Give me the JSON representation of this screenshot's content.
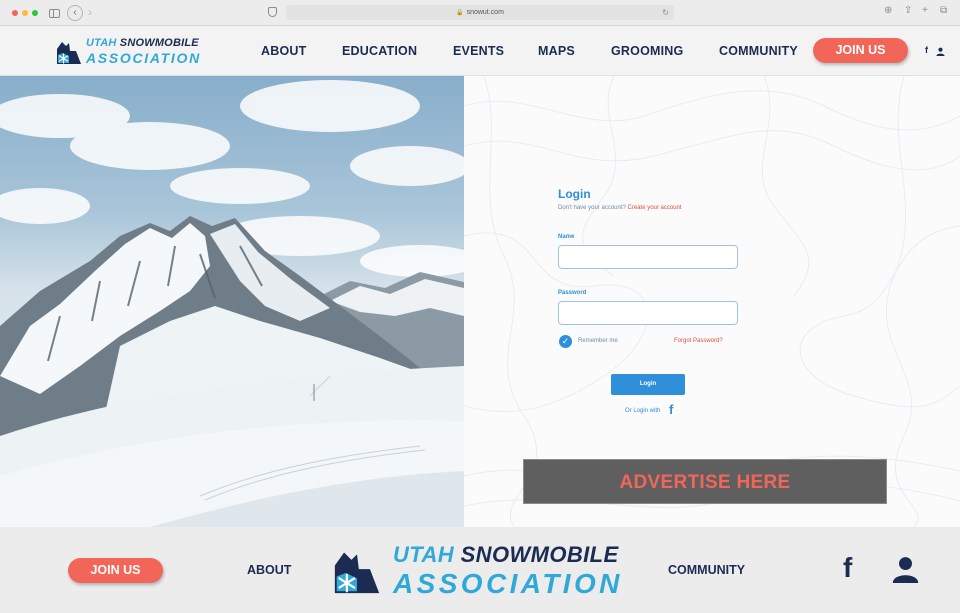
{
  "browser": {
    "url": "snowut.com"
  },
  "brand": {
    "line1_highlight": "UTAH",
    "line1_rest": " SNOWMOBILE",
    "line2": "ASSOCIATION",
    "colors": {
      "navy": "#1b2b52",
      "sky": "#31a9d8",
      "coral": "#f2665a",
      "login_blue": "#2f8fd8"
    }
  },
  "nav": {
    "items": [
      "ABOUT",
      "EDUCATION",
      "EVENTS",
      "MAPS",
      "GROOMING",
      "COMMUNITY"
    ],
    "join_label": "JOIN US",
    "facebook_icon": "facebook-icon",
    "user_icon": "user-icon"
  },
  "login": {
    "title": "Login",
    "no_account_text": "Don't have your account?",
    "create_account_link": "Create your account",
    "name_label": "Name",
    "name_value": "",
    "password_label": "Password",
    "password_value": "",
    "remember_label": "Remember me",
    "remember_checked": true,
    "forgot_link": "Forgot Password?",
    "submit_label": "Login",
    "or_login_with": "Or Login with"
  },
  "ad": {
    "label": "ADVERTISE HERE"
  },
  "footer": {
    "join_label": "JOIN US",
    "about_label": "ABOUT",
    "community_label": "COMMUNITY"
  }
}
